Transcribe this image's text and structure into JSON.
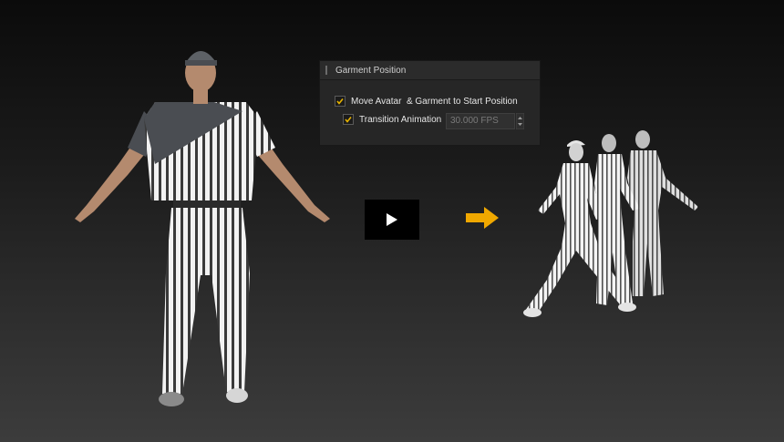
{
  "panel": {
    "title": "Garment Position",
    "move_avatar_label": "Move Avatar  & Garment to Start Position",
    "move_avatar_checked": true,
    "transition_label": "Transition Animation",
    "transition_checked": true,
    "fps_value": "30.000 FPS"
  },
  "colors": {
    "accent": "#f0a800",
    "check": "#e8b400",
    "panel_bg": "#262626"
  },
  "icons": {
    "play": "play-icon",
    "arrow": "arrow-right-icon",
    "check": "checkmark-icon"
  }
}
